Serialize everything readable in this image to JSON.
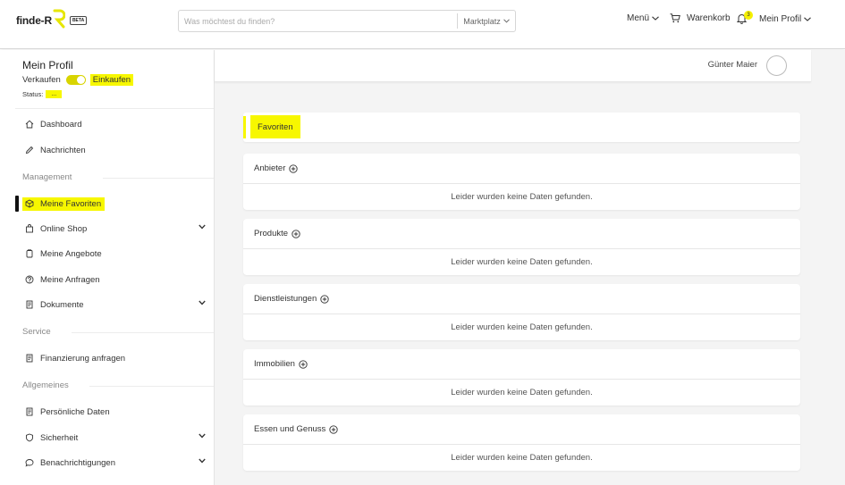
{
  "header": {
    "logo_text": "finde-R",
    "beta": "BETA",
    "search_placeholder": "Was möchtest du finden?",
    "search_category": "Marktplatz",
    "menu_label": "Menü",
    "cart_label": "Warenkorb",
    "notification_count": "3",
    "profile_label": "Mein Profil"
  },
  "sidebar": {
    "title": "Mein Profil",
    "sell_label": "Verkaufen",
    "buy_label": "Einkaufen",
    "status_label": "Status:",
    "status_value": "...",
    "items_top": [
      {
        "label": "Dashboard",
        "icon": "home-icon"
      },
      {
        "label": "Nachrichten",
        "icon": "pencil-icon"
      }
    ],
    "section_management": "Management",
    "items_management": [
      {
        "label": "Meine Favoriten",
        "icon": "box-icon"
      },
      {
        "label": "Online Shop",
        "icon": "shop-icon"
      },
      {
        "label": "Meine Angebote",
        "icon": "tag-icon"
      },
      {
        "label": "Meine Anfragen",
        "icon": "question-icon"
      },
      {
        "label": "Dokumente",
        "icon": "document-icon"
      }
    ],
    "section_service": "Service",
    "items_service": [
      {
        "label": "Finanzierung anfragen",
        "icon": "document-icon"
      }
    ],
    "section_general": "Allgemeines",
    "items_general": [
      {
        "label": "Persönliche Daten",
        "icon": "document-icon"
      },
      {
        "label": "Sicherheit",
        "icon": "shield-icon"
      },
      {
        "label": "Benachrichtigungen",
        "icon": "chat-icon"
      }
    ]
  },
  "main": {
    "user_name": "Günter Maier",
    "favorites_title": "Favoriten",
    "empty_text": "Leider wurden keine Daten gefunden.",
    "sections": [
      {
        "title": "Anbieter"
      },
      {
        "title": "Produkte"
      },
      {
        "title": "Dienstleistungen"
      },
      {
        "title": "Immobilien"
      },
      {
        "title": "Essen und Genuss"
      }
    ]
  },
  "colors": {
    "highlight": "#f7f700",
    "toggle": "#d8d400"
  }
}
